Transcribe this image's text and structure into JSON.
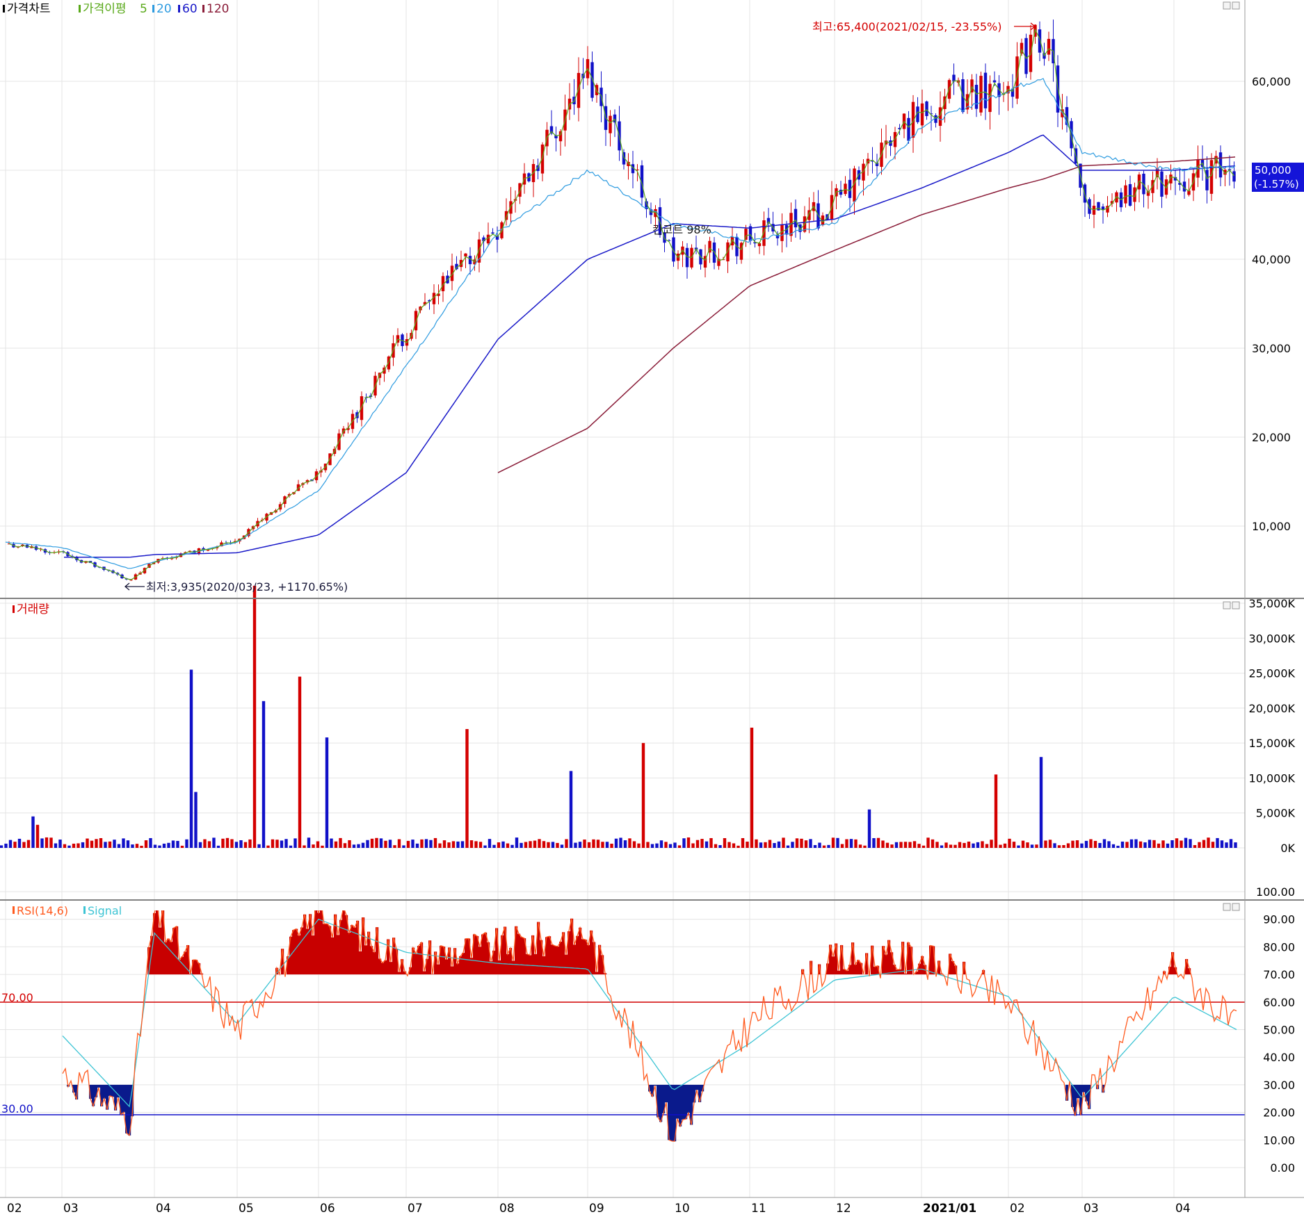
{
  "price_panel": {
    "title": "가격차트",
    "ma_label": "가격이평",
    "ma_periods": [
      "5",
      "20",
      "60",
      "120"
    ],
    "ma_colors": [
      "#58a818",
      "#2d9be0",
      "#1818c8",
      "#8a1c38"
    ],
    "high_annotation": "최고:65,400(2021/02/15, -23.55%)",
    "low_annotation": "최저:3,935(2020/03/23, +1170.65%)",
    "mid_annotation": "킨코트 98%",
    "current_price": "50,000",
    "current_change": "(-1.57%)",
    "y_ticks": [
      "10,000",
      "20,000",
      "30,000",
      "40,000",
      "50,000",
      "60,000"
    ]
  },
  "volume_panel": {
    "title": "거래량",
    "y_ticks": [
      "0K",
      "5,000K",
      "10,000K",
      "15,000K",
      "20,000K",
      "25,000K",
      "30,000K",
      "35,000K"
    ]
  },
  "rsi_panel": {
    "title": "RSI(14,6)",
    "signal_label": "Signal",
    "upper_line": "70.00",
    "lower_line": "30.00",
    "y_ticks": [
      "0.00",
      "10.00",
      "20.00",
      "30.00",
      "40.00",
      "50.00",
      "60.00",
      "70.00",
      "80.00",
      "90.00",
      "100.00"
    ]
  },
  "x_axis": {
    "months": [
      "02",
      "03",
      "04",
      "05",
      "06",
      "07",
      "08",
      "09",
      "10",
      "11",
      "12",
      "2021/01",
      "02",
      "03",
      "04"
    ]
  },
  "colors": {
    "up": "#d40000",
    "down": "#1010c8",
    "rsi": "#ff5a1e",
    "signal": "#3cc4d4",
    "grid": "#e4e4e4",
    "current_price_bg": "#1414d8"
  },
  "chart_data": [
    {
      "type": "line",
      "title": "가격차트",
      "x": [
        "2020/02",
        "2020/03",
        "2020/03/23",
        "2020/04",
        "2020/05",
        "2020/06",
        "2020/07",
        "2020/08",
        "2020/09",
        "2020/10",
        "2020/11",
        "2020/12",
        "2021/01",
        "2021/02",
        "2021/02/15",
        "2021/03",
        "2021/04",
        "2021/04 last"
      ],
      "series": [
        {
          "name": "가격차트",
          "values": [
            8000,
            7000,
            3935,
            6000,
            8500,
            16000,
            32000,
            44000,
            61000,
            40000,
            42000,
            46000,
            57000,
            60000,
            65400,
            46000,
            49000,
            50000
          ]
        },
        {
          "name": "20",
          "values": [
            8200,
            7600,
            5200,
            6000,
            8200,
            14000,
            28000,
            43000,
            50000,
            44000,
            42000,
            44000,
            55000,
            59000,
            60500,
            52000,
            50000,
            50500
          ]
        },
        {
          "name": "60",
          "values": [
            null,
            6500,
            6500,
            6800,
            7000,
            9000,
            16000,
            31000,
            40000,
            44000,
            43500,
            44500,
            48000,
            52000,
            54000,
            50000,
            50000,
            50500
          ]
        },
        {
          "name": "120",
          "values": [
            null,
            null,
            null,
            null,
            null,
            null,
            null,
            16000,
            21000,
            30000,
            37000,
            41000,
            45000,
            48000,
            49000,
            50500,
            51000,
            51500
          ]
        }
      ],
      "ylim": [
        0,
        65000
      ]
    },
    {
      "type": "bar",
      "title": "거래량",
      "x": [
        "03",
        "04",
        "04",
        "05",
        "05",
        "05",
        "06",
        "07",
        "08",
        "09",
        "10",
        "12",
        "2021/01",
        "2021/01",
        "02",
        "04"
      ],
      "values": [
        4500,
        25500,
        8000,
        37500,
        21000,
        24500,
        15800,
        17000,
        11000,
        15000,
        17200,
        5500,
        10500,
        13000,
        3300,
        2300
      ],
      "ylim": [
        0,
        37500
      ]
    },
    {
      "type": "line",
      "title": "RSI(14,6)",
      "x": [
        "2020/03",
        "2020/03/23",
        "2020/04",
        "2020/05",
        "2020/06",
        "2020/07",
        "2020/08",
        "2020/09",
        "2020/10",
        "2020/11",
        "2020/12",
        "2021/01",
        "2021/02",
        "2021/03",
        "2021/04",
        "2021/04 last"
      ],
      "series": [
        {
          "name": "RSI(14,6)",
          "values": [
            35,
            18,
            92,
            50,
            93,
            76,
            80,
            85,
            12,
            52,
            75,
            76,
            60,
            22,
            75,
            50
          ]
        },
        {
          "name": "Signal",
          "values": [
            48,
            22,
            85,
            52,
            90,
            78,
            74,
            72,
            28,
            45,
            68,
            72,
            62,
            25,
            62,
            50
          ]
        }
      ],
      "ylim": [
        0,
        100
      ]
    }
  ]
}
